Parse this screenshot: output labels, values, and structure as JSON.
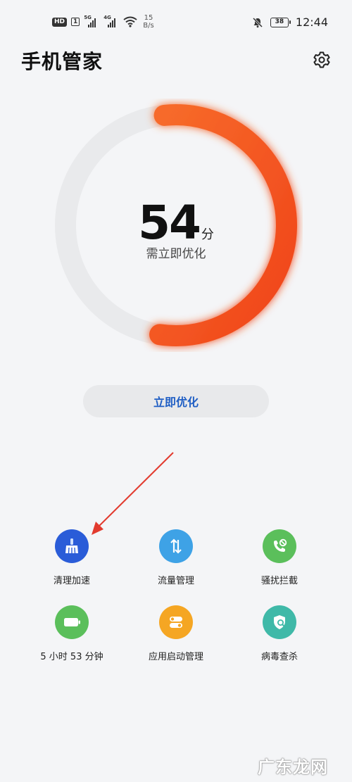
{
  "status_bar": {
    "hd_label": "HD",
    "sim_slot": "1",
    "net1_tag": "5G",
    "net2_tag": "4G",
    "speed_value": "15",
    "speed_unit": "B/s",
    "battery_level": "38",
    "time": "12:44",
    "icons": [
      "hd-icon",
      "signal-icon",
      "wifi-icon",
      "mute-bell-icon",
      "battery-icon"
    ]
  },
  "header": {
    "title": "手机管家",
    "settings_icon": "gear-icon"
  },
  "score": {
    "value": "54",
    "unit": "分",
    "status": "需立即优化",
    "ring_fraction": 0.54,
    "ring_color": "#f3541f",
    "track_color": "#e9eaec"
  },
  "actions": {
    "optimize_label": "立即优化",
    "optimize_color": "#1f5ec4"
  },
  "tools": [
    {
      "label": "清理加速",
      "icon": "broom-icon",
      "color": "#2a5cd8"
    },
    {
      "label": "流量管理",
      "icon": "data-transfer-icon",
      "color": "#3ea2e6"
    },
    {
      "label": "骚扰拦截",
      "icon": "blocked-call-icon",
      "color": "#5bbf5b"
    },
    {
      "label": "5 小时 53 分钟",
      "icon": "battery-icon",
      "color": "#5bbf5b"
    },
    {
      "label": "应用启动管理",
      "icon": "app-launch-icon",
      "color": "#f5a623"
    },
    {
      "label": "病毒查杀",
      "icon": "virus-scan-icon",
      "color": "#3fb9a8"
    }
  ],
  "watermark": "广东龙网"
}
